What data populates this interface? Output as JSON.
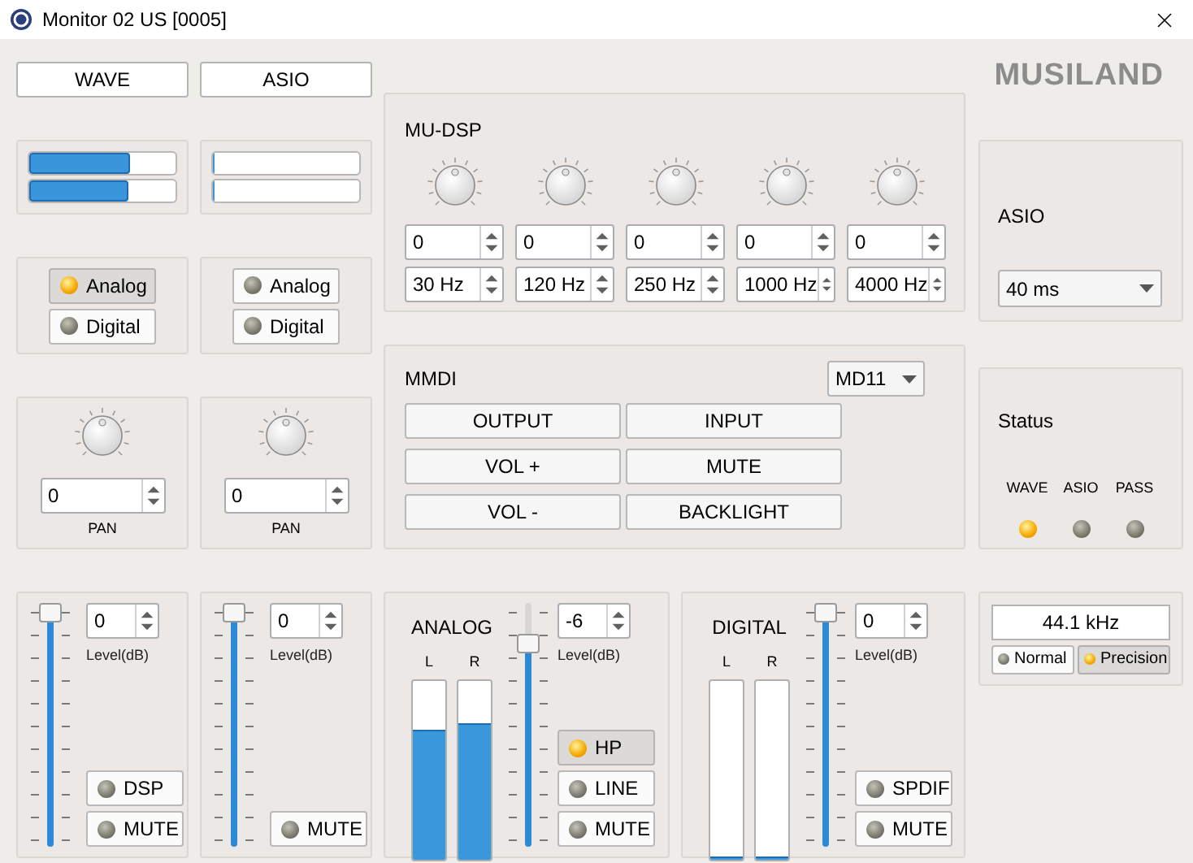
{
  "window": {
    "title": "Monitor 02 US [0005]"
  },
  "channels": [
    {
      "button": "WAVE",
      "meters": [
        {
          "level": 0.69
        },
        {
          "level": 0.68
        }
      ],
      "sources": [
        {
          "label": "Analog",
          "selected": true
        },
        {
          "label": "Digital",
          "selected": false
        }
      ],
      "pan": "0",
      "pan_label": "PAN"
    },
    {
      "button": "ASIO",
      "meters": [
        {
          "level": 0
        },
        {
          "level": 0
        }
      ],
      "sources": [
        {
          "label": "Analog",
          "selected": false
        },
        {
          "label": "Digital",
          "selected": false
        }
      ],
      "pan": "0",
      "pan_label": "PAN"
    }
  ],
  "logo": "MUSILAND",
  "mu_dsp": {
    "title": "MU-DSP",
    "bands": [
      {
        "gain": "0",
        "frequency": "30 Hz"
      },
      {
        "gain": "0",
        "frequency": "120 Hz"
      },
      {
        "gain": "0",
        "frequency": "250 Hz"
      },
      {
        "gain": "0",
        "frequency": "1000 Hz"
      },
      {
        "gain": "0",
        "frequency": "4000 Hz"
      }
    ]
  },
  "mmdi": {
    "title": "MMDI",
    "model": "MD11",
    "buttons": [
      "OUTPUT",
      "INPUT",
      "VOL +",
      "MUTE",
      "VOL -",
      "BACKLIGHT"
    ]
  },
  "asio": {
    "title": "ASIO",
    "buffer": "40 ms"
  },
  "status": {
    "title": "Status",
    "indicators": [
      {
        "label": "WAVE",
        "on": true
      },
      {
        "label": "ASIO",
        "on": false
      },
      {
        "label": "PASS",
        "on": false
      }
    ]
  },
  "mixers": [
    {
      "kind": "channel",
      "level": 1,
      "value": "0",
      "value_label": "Level(dB)",
      "buttons": [
        {
          "label": "DSP",
          "on": false
        },
        {
          "label": "MUTE",
          "on": false
        }
      ]
    },
    {
      "kind": "channel",
      "level": 1,
      "value": "0",
      "value_label": "Level(dB)",
      "buttons": [
        {
          "label": "MUTE",
          "on": false
        }
      ]
    },
    {
      "kind": "output",
      "title": "ANALOG",
      "meters": [
        {
          "label": "L",
          "level": 0.72
        },
        {
          "label": "R",
          "level": 0.76
        }
      ],
      "level": 0.86,
      "value": "-6",
      "value_label": "Level(dB)",
      "buttons": [
        {
          "label": "HP",
          "on": true
        },
        {
          "label": "LINE",
          "on": false
        },
        {
          "label": "MUTE",
          "on": false
        }
      ]
    },
    {
      "kind": "output",
      "title": "DIGITAL",
      "meters": [
        {
          "label": "L",
          "level": 0.01
        },
        {
          "label": "R",
          "level": 0.01
        }
      ],
      "level": 1,
      "value": "0",
      "value_label": "Level(dB)",
      "buttons": [
        {
          "label": "SPDIF",
          "on": false
        },
        {
          "label": "MUTE",
          "on": false
        }
      ]
    }
  ],
  "sample_rate": {
    "value": "44.1 kHz",
    "modes": [
      {
        "label": "Normal",
        "selected": false
      },
      {
        "label": "Precision",
        "selected": true
      }
    ]
  }
}
